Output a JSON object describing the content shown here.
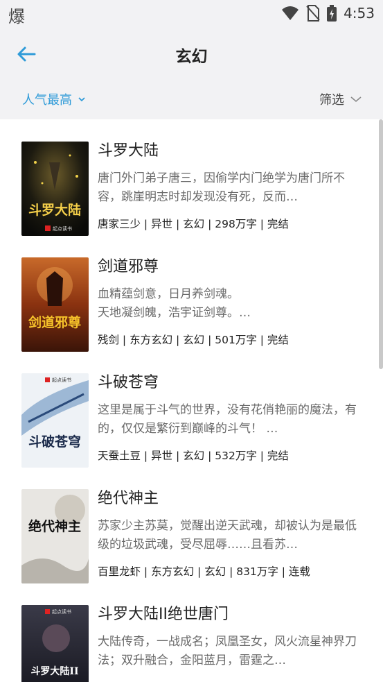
{
  "status_bar": {
    "app_icon_char": "爆",
    "time": "4:53"
  },
  "header": {
    "title": "玄幻"
  },
  "filter_bar": {
    "sort_label": "人气最高",
    "filter_label": "筛选"
  },
  "colors": {
    "accent": "#2f9bd8",
    "background": "#f2f2f4",
    "card": "#ffffff"
  },
  "books": [
    {
      "title": "斗罗大陆",
      "intro": "唐门外门弟子唐三，因偷学内门绝学为唐门所不容，跳崖明志时却发现没有死，反而…",
      "meta": "唐家三少 | 异世 | 玄幻 | 298万字 | 完结",
      "cover_text": "斗罗大陆",
      "cover_brand": "起点读书"
    },
    {
      "title": "剑道邪尊",
      "intro": "血精蕴剑意，日月养剑魂。\n天地凝剑魄，浩宇证剑尊。…",
      "meta": "残剑 | 东方玄幻 | 玄幻 | 501万字 | 完结",
      "cover_text": "剑道邪尊",
      "cover_brand": ""
    },
    {
      "title": "斗破苍穹",
      "intro": "这里是属于斗气的世界，没有花俏艳丽的魔法，有的，仅仅是繁衍到巅峰的斗气！ …",
      "meta": "天蚕土豆 | 异世 | 玄幻 | 532万字 | 完结",
      "cover_text": "斗破苍穹",
      "cover_brand": "起点读书"
    },
    {
      "title": "绝代神主",
      "intro": "苏家少主苏莫，觉醒出逆天武魂，却被认为是最低级的垃圾武魂，受尽屈辱……且看苏…",
      "meta": "百里龙虾 | 东方玄幻 | 玄幻 | 831万字 | 连载",
      "cover_text": "绝代神主",
      "cover_brand": ""
    },
    {
      "title": "斗罗大陆II绝世唐门",
      "intro": "大陆传奇，一战成名；凤凰圣女，风火流星神界刀法；双升融合，金阳蓝月，雷霆之…",
      "meta": "",
      "cover_text": "斗罗大陆II",
      "cover_brand": "起点读书"
    }
  ]
}
